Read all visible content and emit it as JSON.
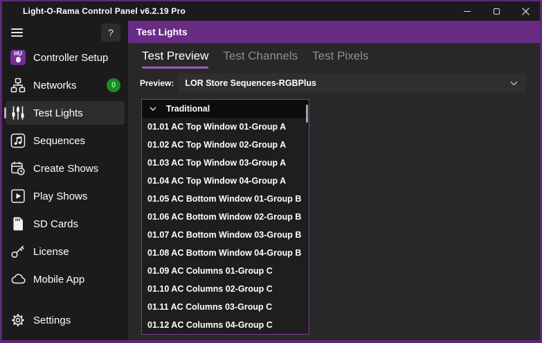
{
  "titlebar": {
    "title": "Light-O-Rama Control Panel v6.2.19 Pro"
  },
  "sidebar": {
    "help_label": "?",
    "hu_logo_text": "HU",
    "items": [
      {
        "label": "Controller Setup"
      },
      {
        "label": "Networks",
        "badge": "0"
      },
      {
        "label": "Test Lights"
      },
      {
        "label": "Sequences"
      },
      {
        "label": "Create Shows"
      },
      {
        "label": "Play Shows"
      },
      {
        "label": "SD Cards"
      },
      {
        "label": "License"
      },
      {
        "label": "Mobile App"
      },
      {
        "label": "Settings"
      }
    ]
  },
  "header": {
    "title": "Test Lights"
  },
  "tabs": {
    "items": [
      {
        "label": "Test Preview",
        "active": true
      },
      {
        "label": "Test Channels",
        "active": false
      },
      {
        "label": "Test Pixels",
        "active": false
      }
    ]
  },
  "preview": {
    "label": "Preview:",
    "selected_value": "LOR Store Sequences-RGBPlus"
  },
  "channel_list": {
    "group_label": "Traditional",
    "items": [
      "01.01 AC Top Window 01-Group A",
      "01.02 AC Top Window 02-Group A",
      "01.03 AC Top Window 03-Group A",
      "01.04 AC Top Window 04-Group A",
      "01.05 AC Bottom Window 01-Group B",
      "01.06 AC Bottom Window 02-Group B",
      "01.07 AC Bottom Window 03-Group B",
      "01.08 AC Bottom Window 04-Group B",
      "01.09 AC Columns 01-Group C",
      "01.10 AC Columns 02-Group C",
      "01.11 AC Columns 03-Group C",
      "01.12 AC Columns 04-Group C"
    ]
  },
  "colors": {
    "header_purple": "#682b86",
    "window_border_purple": "#5e2878",
    "tab_underline": "#a35cbd",
    "selected_pill": "#cd9fdb",
    "badge_green_bg": "#1d8c27",
    "badge_green_text": "#90ee90",
    "hu_logo_purple": "#6d2a90"
  }
}
